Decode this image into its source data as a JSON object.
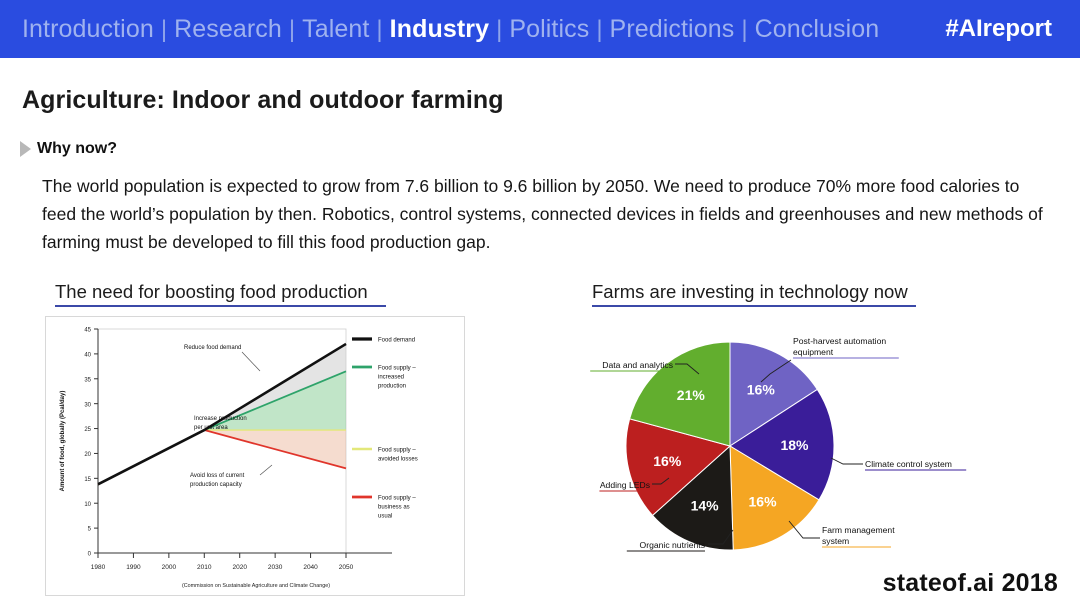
{
  "header": {
    "nav": [
      {
        "label": "Introduction",
        "active": false
      },
      {
        "label": "Research",
        "active": false
      },
      {
        "label": "Talent",
        "active": false
      },
      {
        "label": "Industry",
        "active": true
      },
      {
        "label": "Politics",
        "active": false
      },
      {
        "label": "Predictions",
        "active": false
      },
      {
        "label": "Conclusion",
        "active": false
      }
    ],
    "separator": "|",
    "hashtag": "#AIreport",
    "bar_color": "#2a4ce0",
    "active_color": "#ffffff",
    "inactive_color": "#9fb2ef"
  },
  "slide": {
    "title": "Agriculture: Indoor and outdoor farming",
    "bullet_label": "Why now?",
    "body": "The world population is expected to grow from 7.6 billion to 9.6 billion by 2050. We need to produce 70% more food calories to feed the world’s population by then. Robotics, control systems, connected devices in fields and greenhouses and new methods of farming must be developed to fill this food production gap.",
    "brand": "stateof.ai 2018",
    "rule_color": "#3b49a8"
  },
  "left_panel": {
    "heading": "The need for boosting food production"
  },
  "right_panel": {
    "heading": "Farms are investing in technology now"
  },
  "chart_data": [
    {
      "type": "line",
      "title": "The need for boosting food production",
      "xlabel": "",
      "ylabel": "Amount of food, globally (Pcal/day)",
      "caption": "(Commission on Sustainable Agriculture and Climate Change)",
      "xlim": [
        1980,
        2050
      ],
      "ylim": [
        0,
        45
      ],
      "xticks": [
        1980,
        1990,
        2000,
        2010,
        2020,
        2030,
        2040,
        2050
      ],
      "yticks": [
        0,
        5,
        10,
        15,
        20,
        25,
        30,
        35,
        40,
        45
      ],
      "grid": false,
      "legend_position": "right",
      "annotations": [
        {
          "text": "Reduce food demand",
          "x": 2022,
          "y": 35
        },
        {
          "text": "Increase production per unit area",
          "x": 2028,
          "y": 26
        },
        {
          "text": "Avoid loss of current production capacity",
          "x": 2030,
          "y": 14
        }
      ],
      "series": [
        {
          "name": "Food demand",
          "color": "#111111",
          "x": [
            1980,
            2010,
            2050
          ],
          "values": [
            13.8,
            24.7,
            42.0
          ]
        },
        {
          "name": "Food supply – increased production",
          "color": "#2ea36a",
          "x": [
            1980,
            2010,
            2050
          ],
          "values": [
            13.8,
            24.7,
            36.5
          ]
        },
        {
          "name": "Food supply – avoided losses",
          "color": "#e3e87a",
          "x": [
            1980,
            2010,
            2050
          ],
          "values": [
            13.8,
            24.7,
            24.7
          ]
        },
        {
          "name": "Food supply – business as usual",
          "color": "#e0352b",
          "x": [
            1980,
            2010,
            2050
          ],
          "values": [
            13.8,
            24.7,
            17.0
          ]
        }
      ]
    },
    {
      "type": "pie",
      "title": "Farms are investing in technology now",
      "legend_position": "callout-labels",
      "labels": [
        "Post-harvest automation equipment",
        "Climate control system",
        "Farm management system",
        "Organic nutrients",
        "Adding LEDs",
        "Data and analytics"
      ],
      "values": [
        16,
        18,
        16,
        14,
        16,
        21
      ],
      "value_labels": [
        "16%",
        "18%",
        "16%",
        "14%",
        "16%",
        "21%"
      ],
      "colors": [
        "#6f63c4",
        "#3a1d99",
        "#f5a623",
        "#1c1a17",
        "#bc1f1f",
        "#62ae2e"
      ]
    }
  ]
}
